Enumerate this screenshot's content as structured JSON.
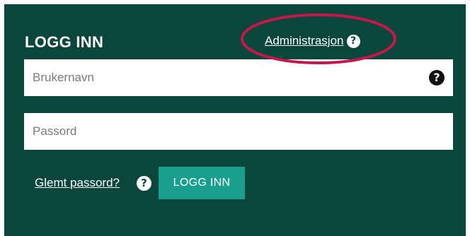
{
  "login": {
    "title": "LOGG INN",
    "admin_link": "Administrasjon",
    "username_placeholder": "Brukernavn",
    "password_placeholder": "Passord",
    "forgot_link": "Glemt passord?",
    "submit_label": "LOGG INN",
    "help_glyph": "?"
  },
  "colors": {
    "panel_bg": "#0a463c",
    "button_bg": "#1a9e8e",
    "highlight": "#c2184b"
  },
  "icons": {
    "help": "help-circle-icon",
    "annotation": "highlight-ellipse"
  }
}
